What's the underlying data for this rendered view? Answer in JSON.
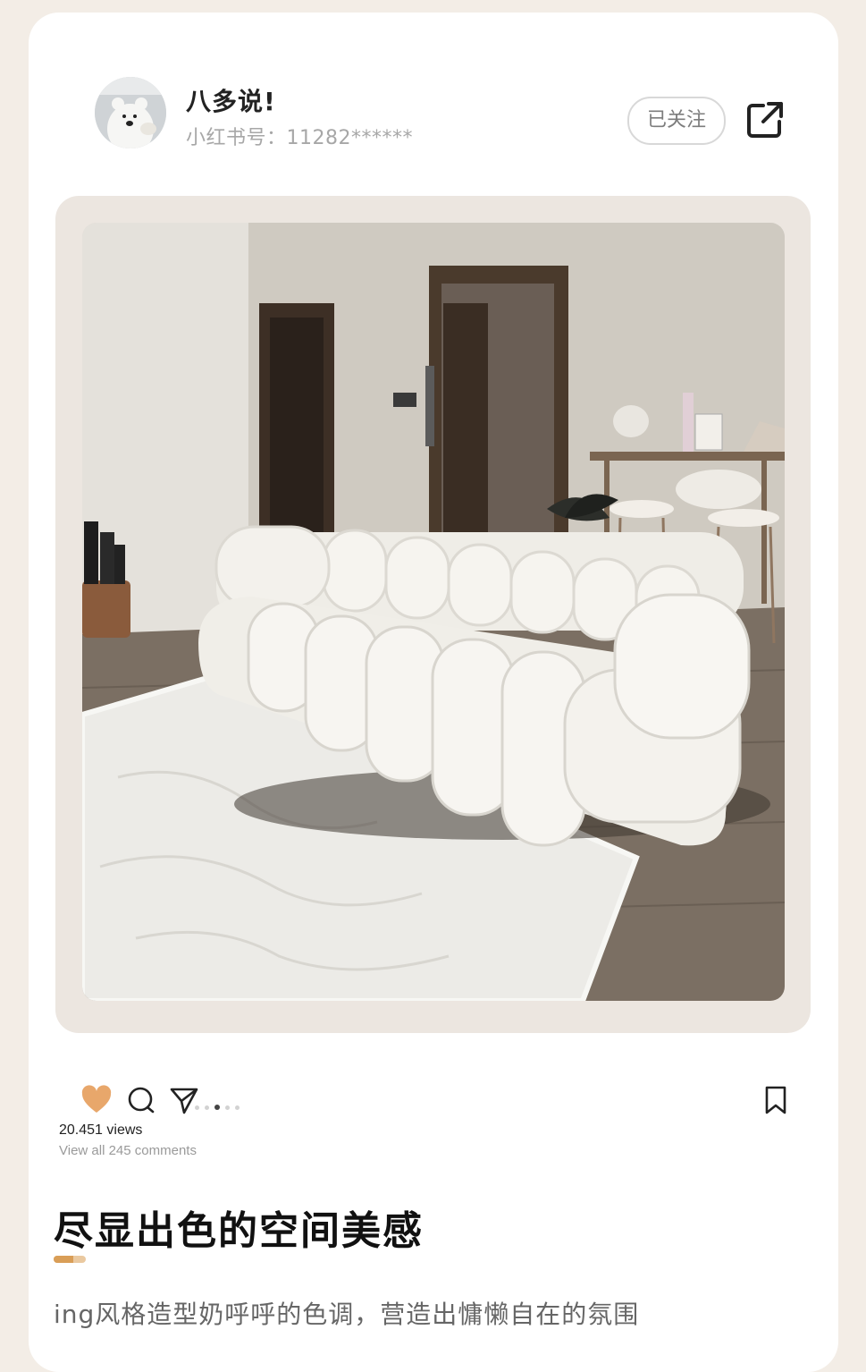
{
  "user": {
    "name": "八多说!",
    "id_label": "小红书号：",
    "id_value": "11282******",
    "follow_label": "已关注"
  },
  "post": {
    "views": "20.451 views",
    "comments": "View all 245 comments",
    "title": "尽显出色的空间美感",
    "description": "ing风格造型奶呼呼的色调，营造出慵懒自在的氛围",
    "carousel_total": 5,
    "carousel_active": 3
  },
  "colors": {
    "accent": "#d99e57",
    "heart": "#e8a76b",
    "frame": "#ece6e0"
  },
  "icons": [
    "heart-icon",
    "comment-icon",
    "send-icon",
    "bookmark-icon",
    "share-icon"
  ]
}
